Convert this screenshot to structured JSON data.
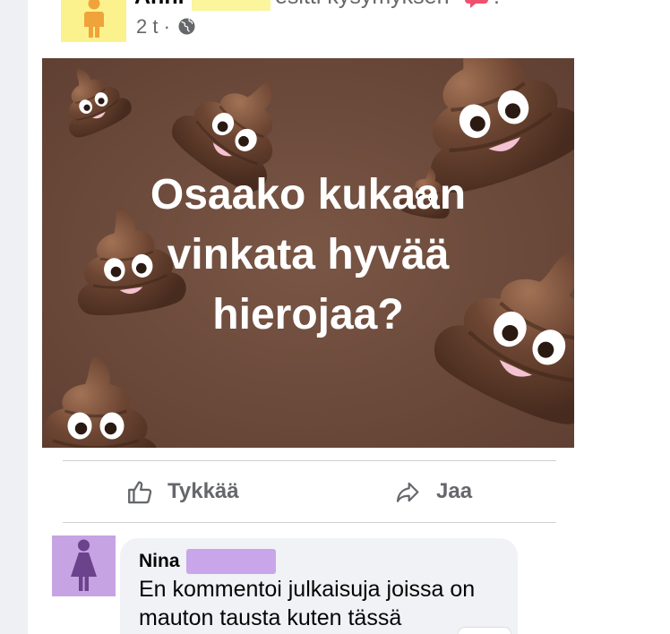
{
  "post": {
    "author": "Anni",
    "action": "esitti kysymyksen",
    "trailing": ".",
    "time": "2 t ·",
    "icons": {
      "avatar": "person-icon",
      "action": "speech-bubble-icon",
      "privacy": "globe-icon"
    },
    "colors": {
      "avatar_bg": "#fbf28d",
      "avatar_figure": "#f0a33a",
      "redaction": "#fbf59c",
      "action_icon": "#f0506e"
    },
    "image": {
      "text_lines": [
        "Osaako kukaan",
        "vinkata hyvää",
        "hierojaa?"
      ],
      "background": "#6f4c3c",
      "decoration_icon": "poop-emoji-icon"
    }
  },
  "actions": [
    {
      "label": "Tykkää",
      "icon": "thumbs-up-icon"
    },
    {
      "label": "Jaa",
      "icon": "share-icon"
    }
  ],
  "comment": {
    "author": "Nina",
    "text_lines": [
      "En kommentoi julkaisuja joissa on",
      "mauton tausta kuten tässä"
    ],
    "icons": {
      "avatar": "female-person-icon"
    },
    "colors": {
      "avatar_bg": "#c6a3e2",
      "avatar_figure": "#6b428c",
      "redaction": "#c9a6ea",
      "bubble": "#f0f2f5"
    }
  }
}
